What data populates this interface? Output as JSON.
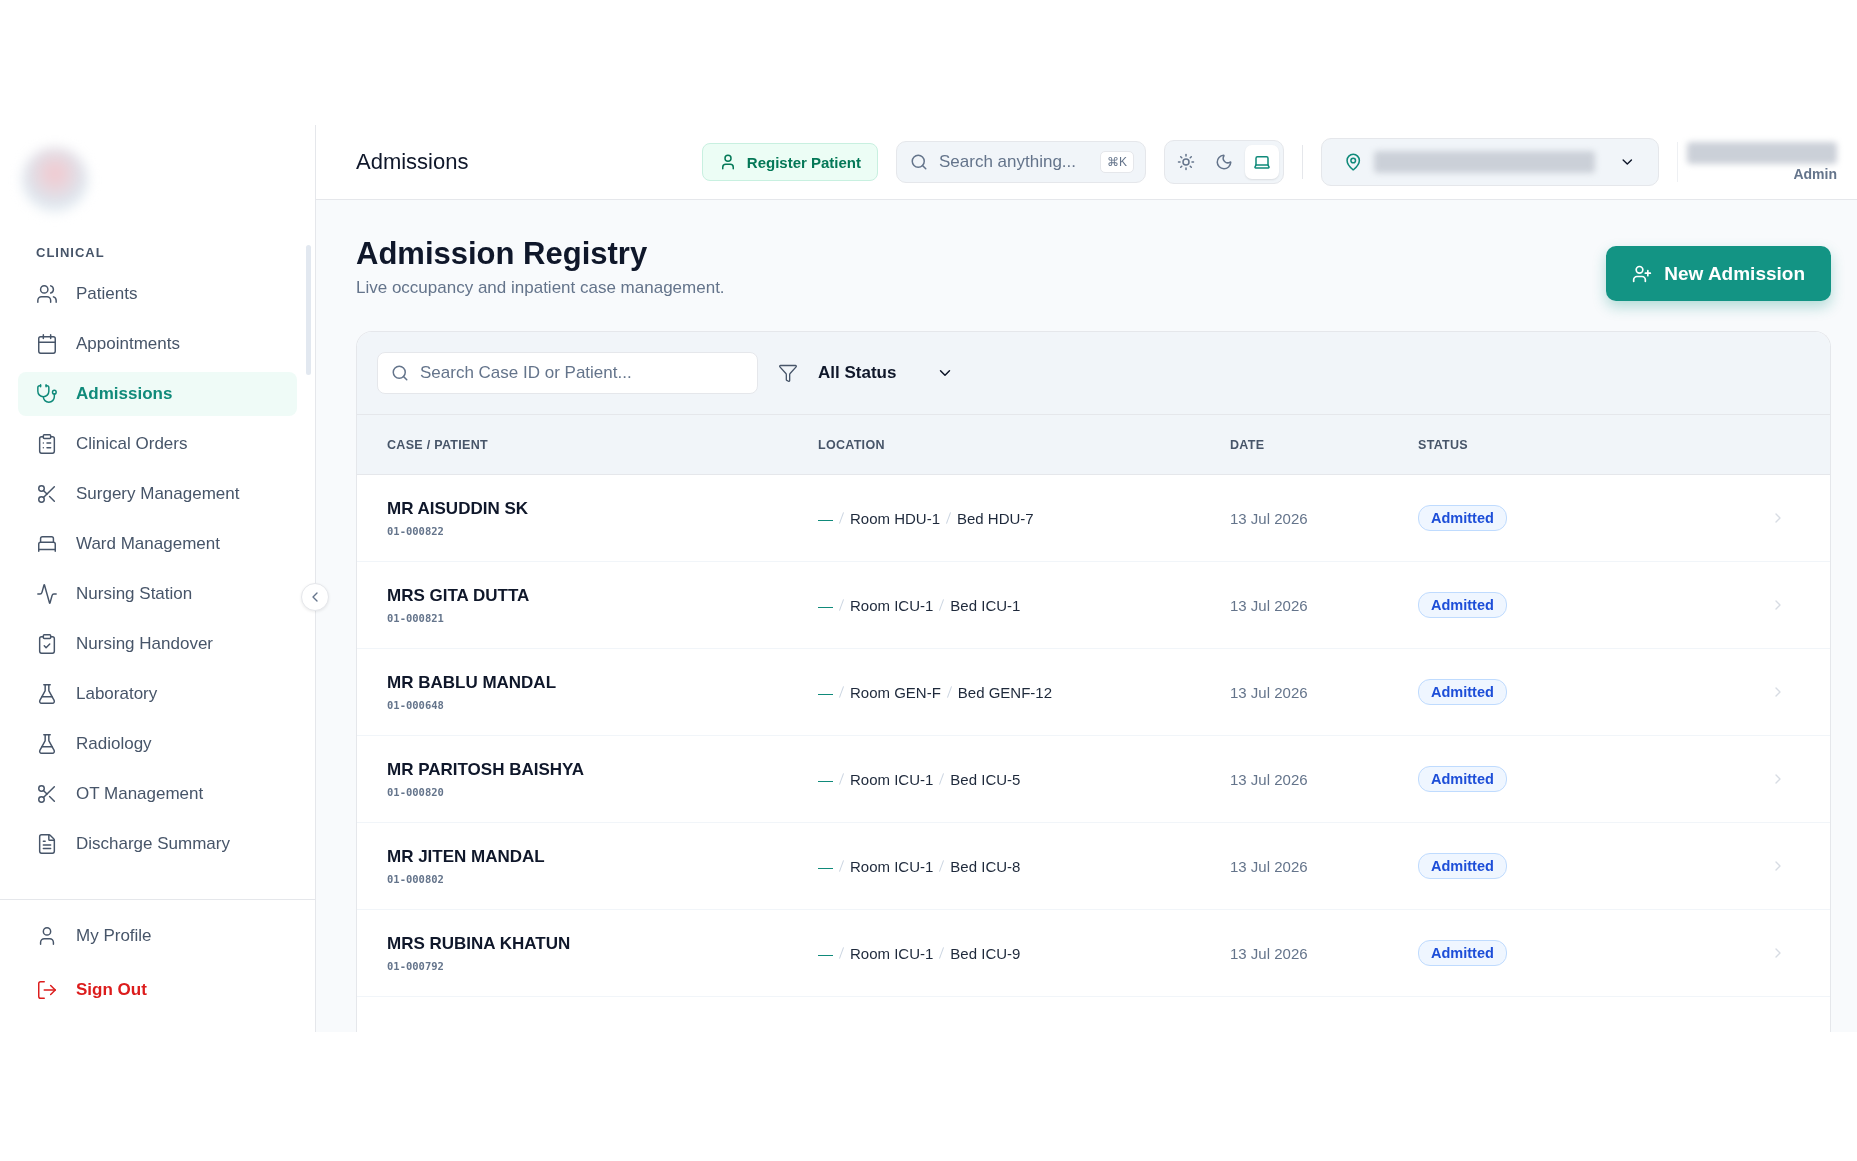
{
  "sidebar": {
    "section": "CLINICAL",
    "items": [
      {
        "label": "Patients",
        "selected": false
      },
      {
        "label": "Appointments",
        "selected": false
      },
      {
        "label": "Admissions",
        "selected": true
      },
      {
        "label": "Clinical Orders",
        "selected": false
      },
      {
        "label": "Surgery Management",
        "selected": false
      },
      {
        "label": "Ward Management",
        "selected": false
      },
      {
        "label": "Nursing Station",
        "selected": false
      },
      {
        "label": "Nursing Handover",
        "selected": false
      },
      {
        "label": "Laboratory",
        "selected": false
      },
      {
        "label": "Radiology",
        "selected": false
      },
      {
        "label": "OT Management",
        "selected": false
      },
      {
        "label": "Discharge Summary",
        "selected": false
      }
    ],
    "footer": [
      {
        "label": "My Profile",
        "kind": "profile"
      },
      {
        "label": "Sign Out",
        "kind": "signout"
      }
    ]
  },
  "header": {
    "title": "Admissions",
    "register_button": "Register Patient",
    "search": {
      "placeholder": "Search anything...",
      "shortcut": "⌘K"
    },
    "theme_options": [
      {
        "kind": "light",
        "selected": false
      },
      {
        "kind": "dark",
        "selected": false
      },
      {
        "kind": "system",
        "selected": true
      }
    ],
    "user_role": "Admin"
  },
  "page": {
    "title": "Admission Registry",
    "subtitle": "Live occupancy and inpatient case management.",
    "new_button": "New Admission"
  },
  "filters": {
    "search": {
      "placeholder": "Search Case ID or Patient..."
    },
    "status": "All Status"
  },
  "table": {
    "columns": [
      "CASE / PATIENT",
      "LOCATION",
      "DATE",
      "STATUS"
    ],
    "rows": [
      {
        "name": "MR AISUDDIN SK",
        "case_id": "01-000822",
        "ward": "—",
        "room": "Room HDU-1",
        "bed": "Bed HDU-7",
        "date": "13 Jul 2026",
        "status": "Admitted"
      },
      {
        "name": "MRS GITA DUTTA",
        "case_id": "01-000821",
        "ward": "—",
        "room": "Room ICU-1",
        "bed": "Bed ICU-1",
        "date": "13 Jul 2026",
        "status": "Admitted"
      },
      {
        "name": "MR BABLU MANDAL",
        "case_id": "01-000648",
        "ward": "—",
        "room": "Room GEN-F",
        "bed": "Bed GENF-12",
        "date": "13 Jul 2026",
        "status": "Admitted"
      },
      {
        "name": "MR PARITOSH BAISHYA",
        "case_id": "01-000820",
        "ward": "—",
        "room": "Room ICU-1",
        "bed": "Bed ICU-5",
        "date": "13 Jul 2026",
        "status": "Admitted"
      },
      {
        "name": "MR JITEN MANDAL",
        "case_id": "01-000802",
        "ward": "—",
        "room": "Room ICU-1",
        "bed": "Bed ICU-8",
        "date": "13 Jul 2026",
        "status": "Admitted"
      },
      {
        "name": "MRS RUBINA KHATUN",
        "case_id": "01-000792",
        "ward": "—",
        "room": "Room ICU-1",
        "bed": "Bed ICU-9",
        "date": "13 Jul 2026",
        "status": "Admitted"
      }
    ]
  }
}
